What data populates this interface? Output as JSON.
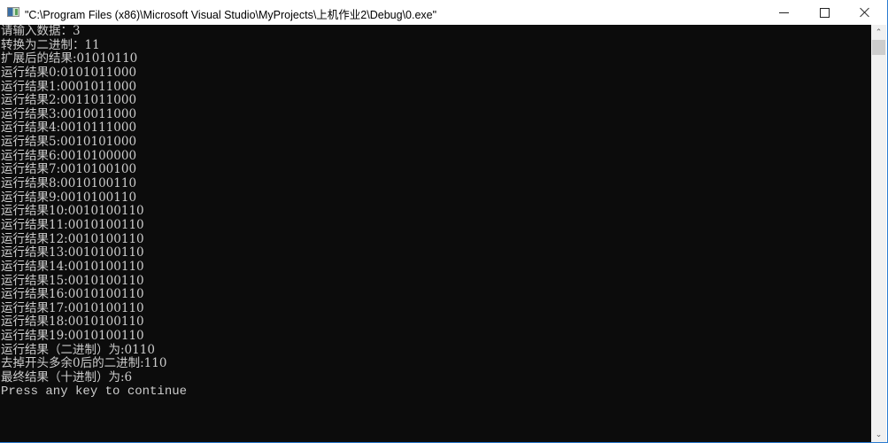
{
  "window": {
    "title": "\"C:\\Program Files (x86)\\Microsoft Visual Studio\\MyProjects\\上机作业2\\Debug\\0.exe\"",
    "controls": {
      "minimize": "minimize-icon",
      "maximize": "maximize-icon",
      "close": "close-icon"
    }
  },
  "console": {
    "lines": [
      "请输入数据：3",
      "转换为二进制：11",
      "扩展后的结果:01010110",
      "运行结果0:0101011000",
      "运行结果1:0001011000",
      "运行结果2:0011011000",
      "运行结果3:0010011000",
      "运行结果4:0010111000",
      "运行结果5:0010101000",
      "运行结果6:0010100000",
      "运行结果7:0010100100",
      "运行结果8:0010100110",
      "运行结果9:0010100110",
      "运行结果10:0010100110",
      "运行结果11:0010100110",
      "运行结果12:0010100110",
      "运行结果13:0010100110",
      "运行结果14:0010100110",
      "运行结果15:0010100110",
      "运行结果16:0010100110",
      "运行结果17:0010100110",
      "运行结果18:0010100110",
      "运行结果19:0010100110",
      "运行结果（二进制）为:0110",
      "去掉开头多余0后的二进制:110",
      "最终结果（十进制）为:6",
      "Press any key to continue"
    ]
  },
  "scrollbar": {
    "up_icon": "chevron-up-icon",
    "down_icon": "chevron-down-icon"
  }
}
